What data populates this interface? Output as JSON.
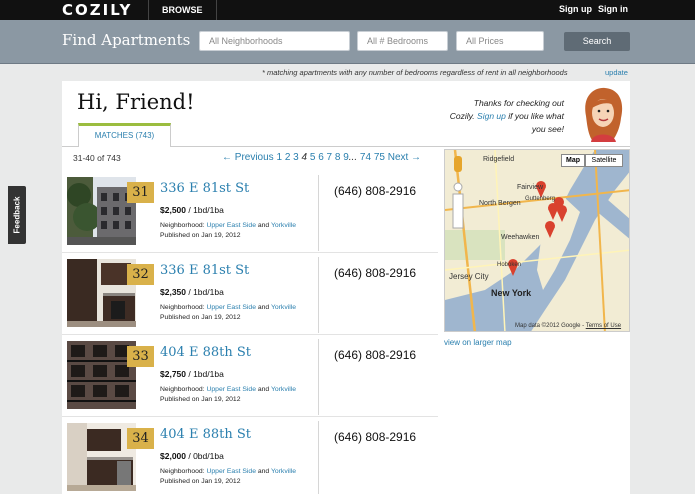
{
  "header": {
    "logo": "COZILY",
    "browse": "BROWSE",
    "signup": "Sign up",
    "signin": "Sign in"
  },
  "search": {
    "title": "Find Apartments",
    "neighborhoods": "All Neighborhoods",
    "bedrooms": "All # Bedrooms",
    "prices": "All Prices",
    "button": "Search",
    "note": "* matching apartments with any number of bedrooms regardless of rent in all neighborhoods",
    "update": "update"
  },
  "greeting": "Hi, Friend!",
  "tab_label": "MATCHES (743)",
  "thanks": {
    "line1": "Thanks for checking out",
    "line2_pre": "Cozily. ",
    "signup_link": "Sign up",
    "line2_post": " if you like what",
    "line3": "you see!"
  },
  "results": {
    "count": "31-40 of 743",
    "prev": "← Previous",
    "pages": [
      "1",
      "2",
      "3",
      "4",
      "5",
      "6",
      "7",
      "8",
      "9",
      "...",
      "74",
      "75"
    ],
    "current_page": "4",
    "next": "Next →"
  },
  "listings": [
    {
      "num": "31",
      "address": "336 E 81st St",
      "price": "$2,500",
      "beds": " / 1bd/1ba",
      "label_neighborhood": "Neighborhood:",
      "hood1": "Upper East Side",
      "and": " and ",
      "hood2": "Yorkville",
      "published": "Published on Jan 19, 2012",
      "phone": "(646) 808-2916"
    },
    {
      "num": "32",
      "address": "336 E 81st St",
      "price": "$2,350",
      "beds": " / 1bd/1ba",
      "label_neighborhood": "Neighborhood:",
      "hood1": "Upper East Side",
      "and": " and ",
      "hood2": "Yorkville",
      "published": "Published on Jan 19, 2012",
      "phone": "(646) 808-2916"
    },
    {
      "num": "33",
      "address": "404 E 88th St",
      "price": "$2,750",
      "beds": " / 1bd/1ba",
      "label_neighborhood": "Neighborhood:",
      "hood1": "Upper East Side",
      "and": " and ",
      "hood2": "Yorkville",
      "published": "Published on Jan 19, 2012",
      "phone": "(646) 808-2916"
    },
    {
      "num": "34",
      "address": "404 E 88th St",
      "price": "$2,000",
      "beds": " / 0bd/1ba",
      "label_neighborhood": "Neighborhood:",
      "hood1": "Upper East Side",
      "and": " and ",
      "hood2": "Yorkville",
      "published": "Published on Jan 19, 2012",
      "phone": "(646) 808-2916"
    }
  ],
  "map": {
    "btn_map": "Map",
    "btn_satellite": "Satellite",
    "labels": [
      "Ridgefield",
      "Fairview",
      "North Bergen",
      "Guttenberg",
      "Weehawken",
      "Jersey City",
      "Hoboken",
      "New York"
    ],
    "credit": "Map data ©2012 Google",
    "terms": "Terms of Use",
    "larger_link": "view on larger map"
  },
  "feedback": "Feedback",
  "colors": {
    "accent": "#2a7fae",
    "number_badge": "#d9b14a",
    "tab_top": "#9bbd3f",
    "searchbar": "#8b98a3"
  }
}
